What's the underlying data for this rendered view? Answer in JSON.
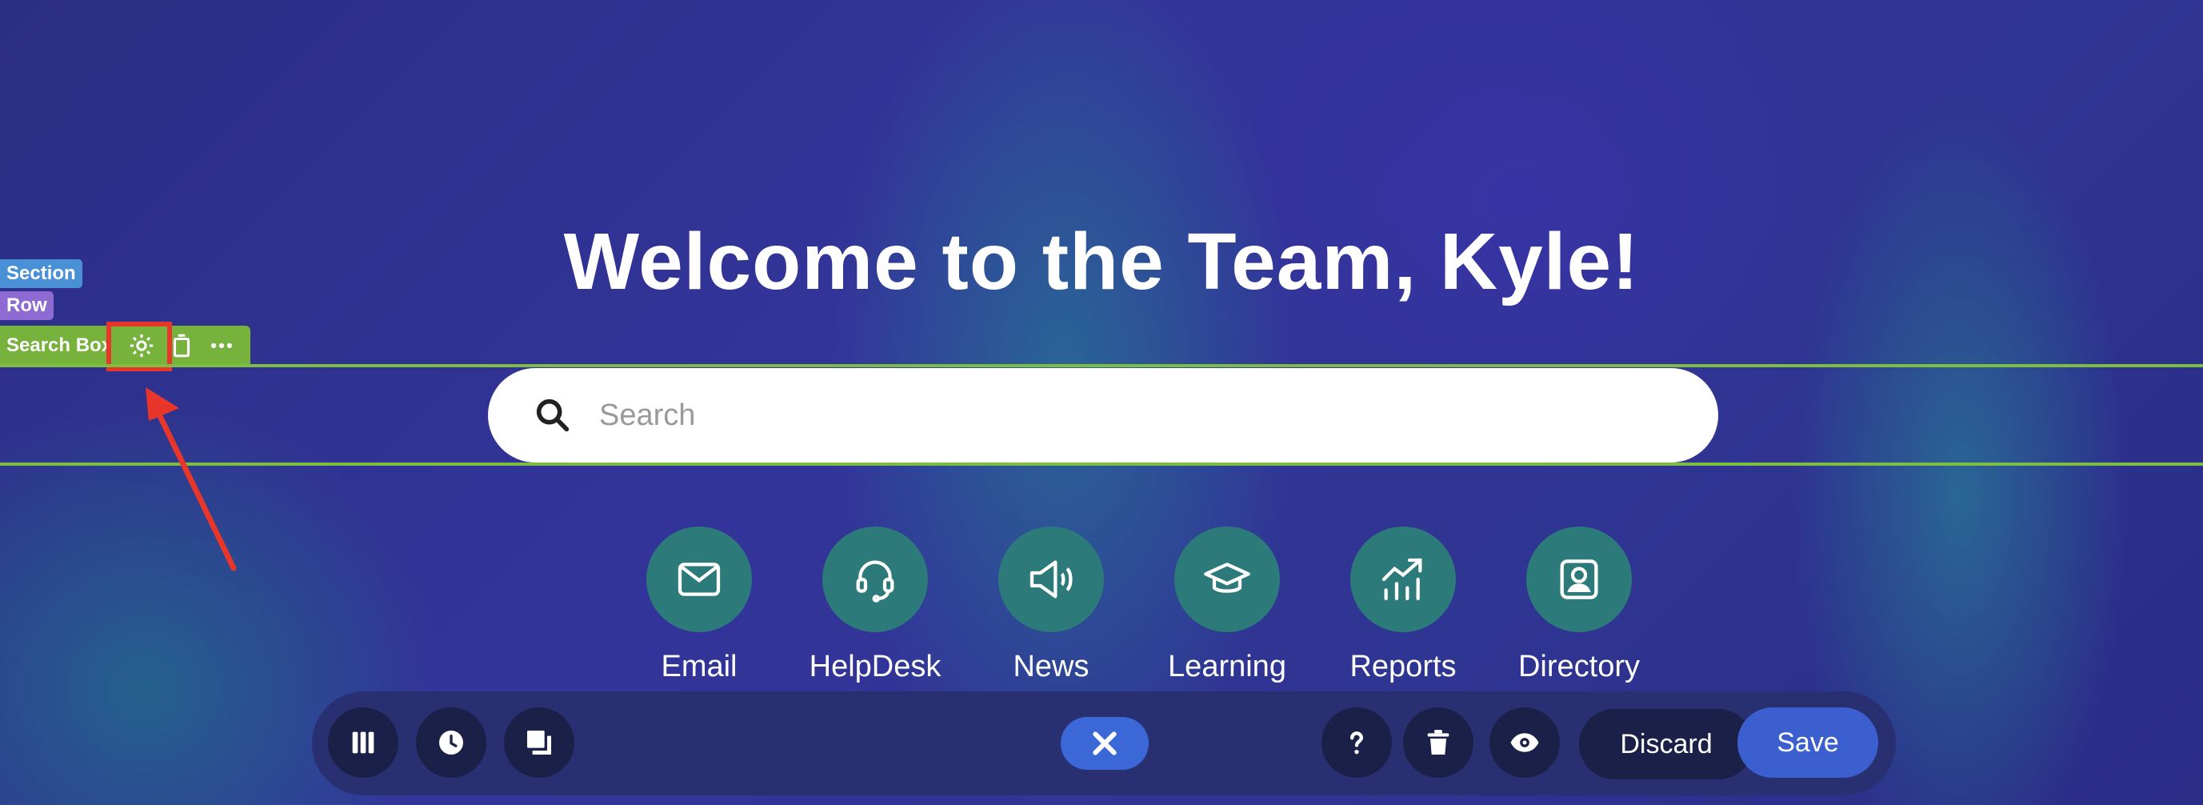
{
  "heading": "Welcome to the Team, Kyle!",
  "search": {
    "placeholder": "Search"
  },
  "editor_overlay": {
    "section_label": "Section",
    "row_label": "Row",
    "component_label": "Search Box"
  },
  "quick_links": [
    {
      "label": "Email",
      "icon": "mail-icon"
    },
    {
      "label": "HelpDesk",
      "icon": "headset-icon"
    },
    {
      "label": "News",
      "icon": "megaphone-icon"
    },
    {
      "label": "Learning",
      "icon": "graduation-cap-icon"
    },
    {
      "label": "Reports",
      "icon": "chart-up-icon"
    },
    {
      "label": "Directory",
      "icon": "contact-card-icon"
    }
  ],
  "bottom_toolbar": {
    "discard_label": "Discard",
    "save_label": "Save"
  },
  "colors": {
    "accent_green": "#77b23c",
    "highlight_red": "#e8372a",
    "link_teal": "#2d7a7a",
    "save_blue": "#3c5fd0"
  }
}
